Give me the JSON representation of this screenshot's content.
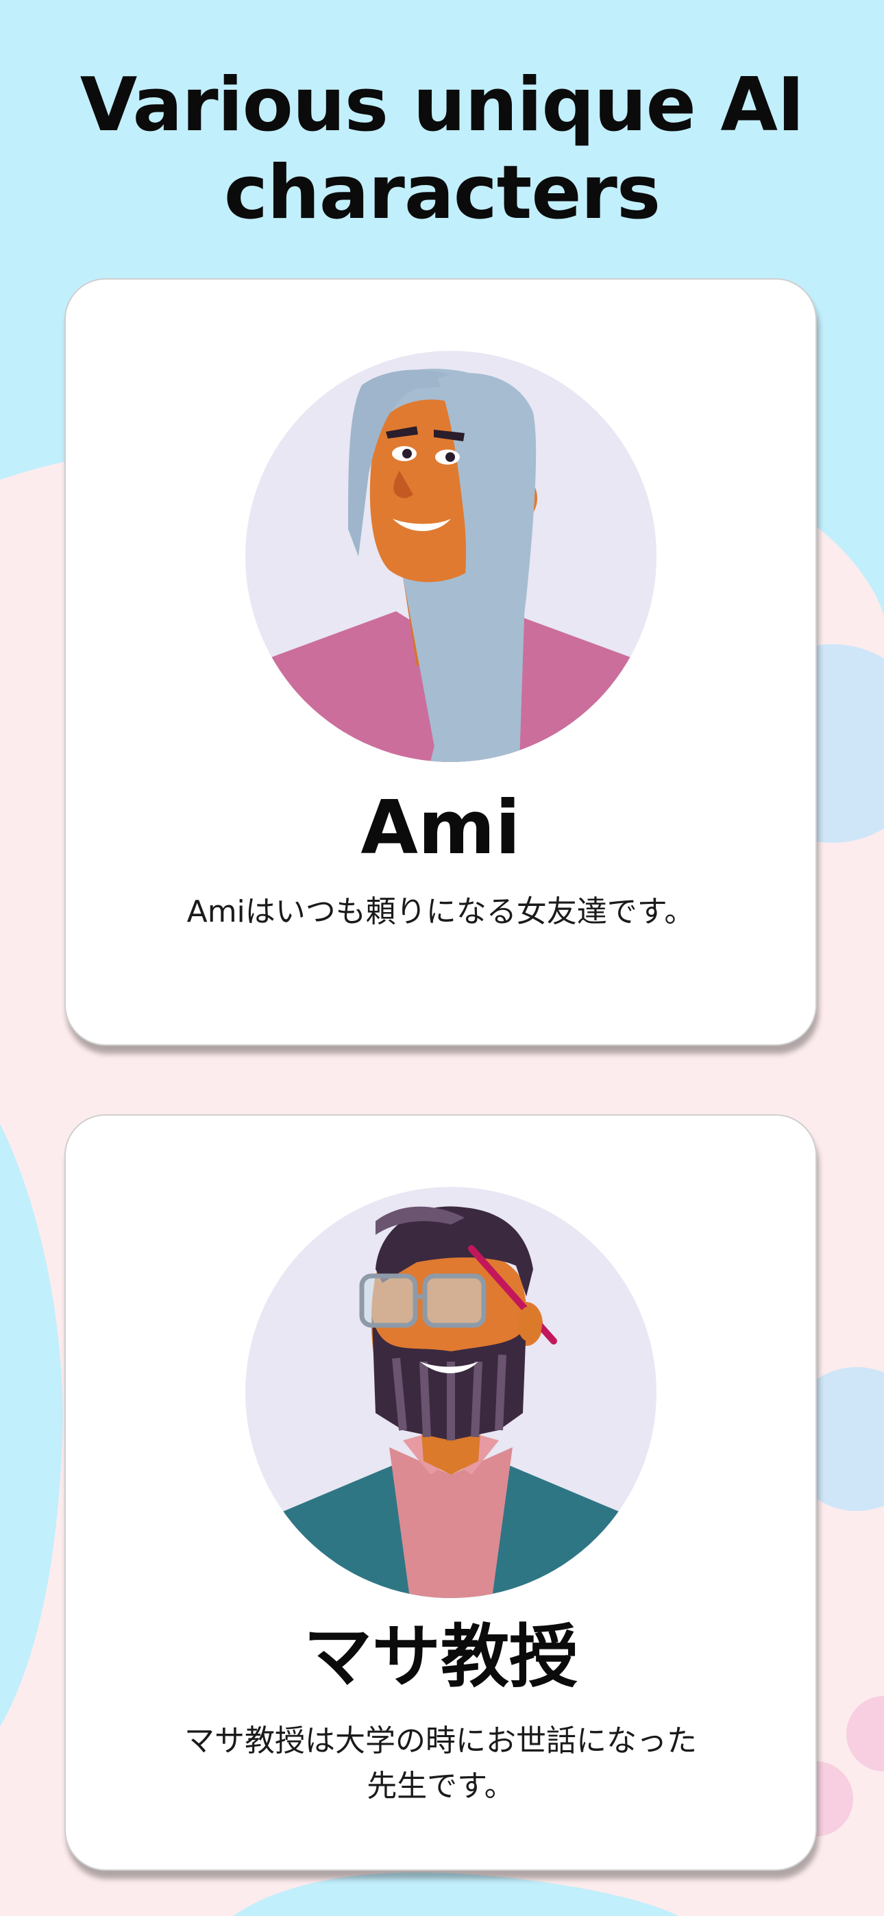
{
  "header": {
    "title_line1": "Various unique AI",
    "title_line2": "characters"
  },
  "characters": [
    {
      "name": "Ami",
      "description": "Amiはいつも頼りになる女友達です。",
      "avatar_icon": "woman-avatar-illustration"
    },
    {
      "name": "マサ教授",
      "description_line1": "マサ教授は大学の時にお世話になった",
      "description_line2": "先生です。",
      "avatar_icon": "bearded-professor-avatar-illustration"
    }
  ],
  "colors": {
    "sky_blue": "#c2effc",
    "blush_pink": "#fdeced",
    "card_white": "#ffffff",
    "avatar_circle": "#e8e7f3"
  }
}
